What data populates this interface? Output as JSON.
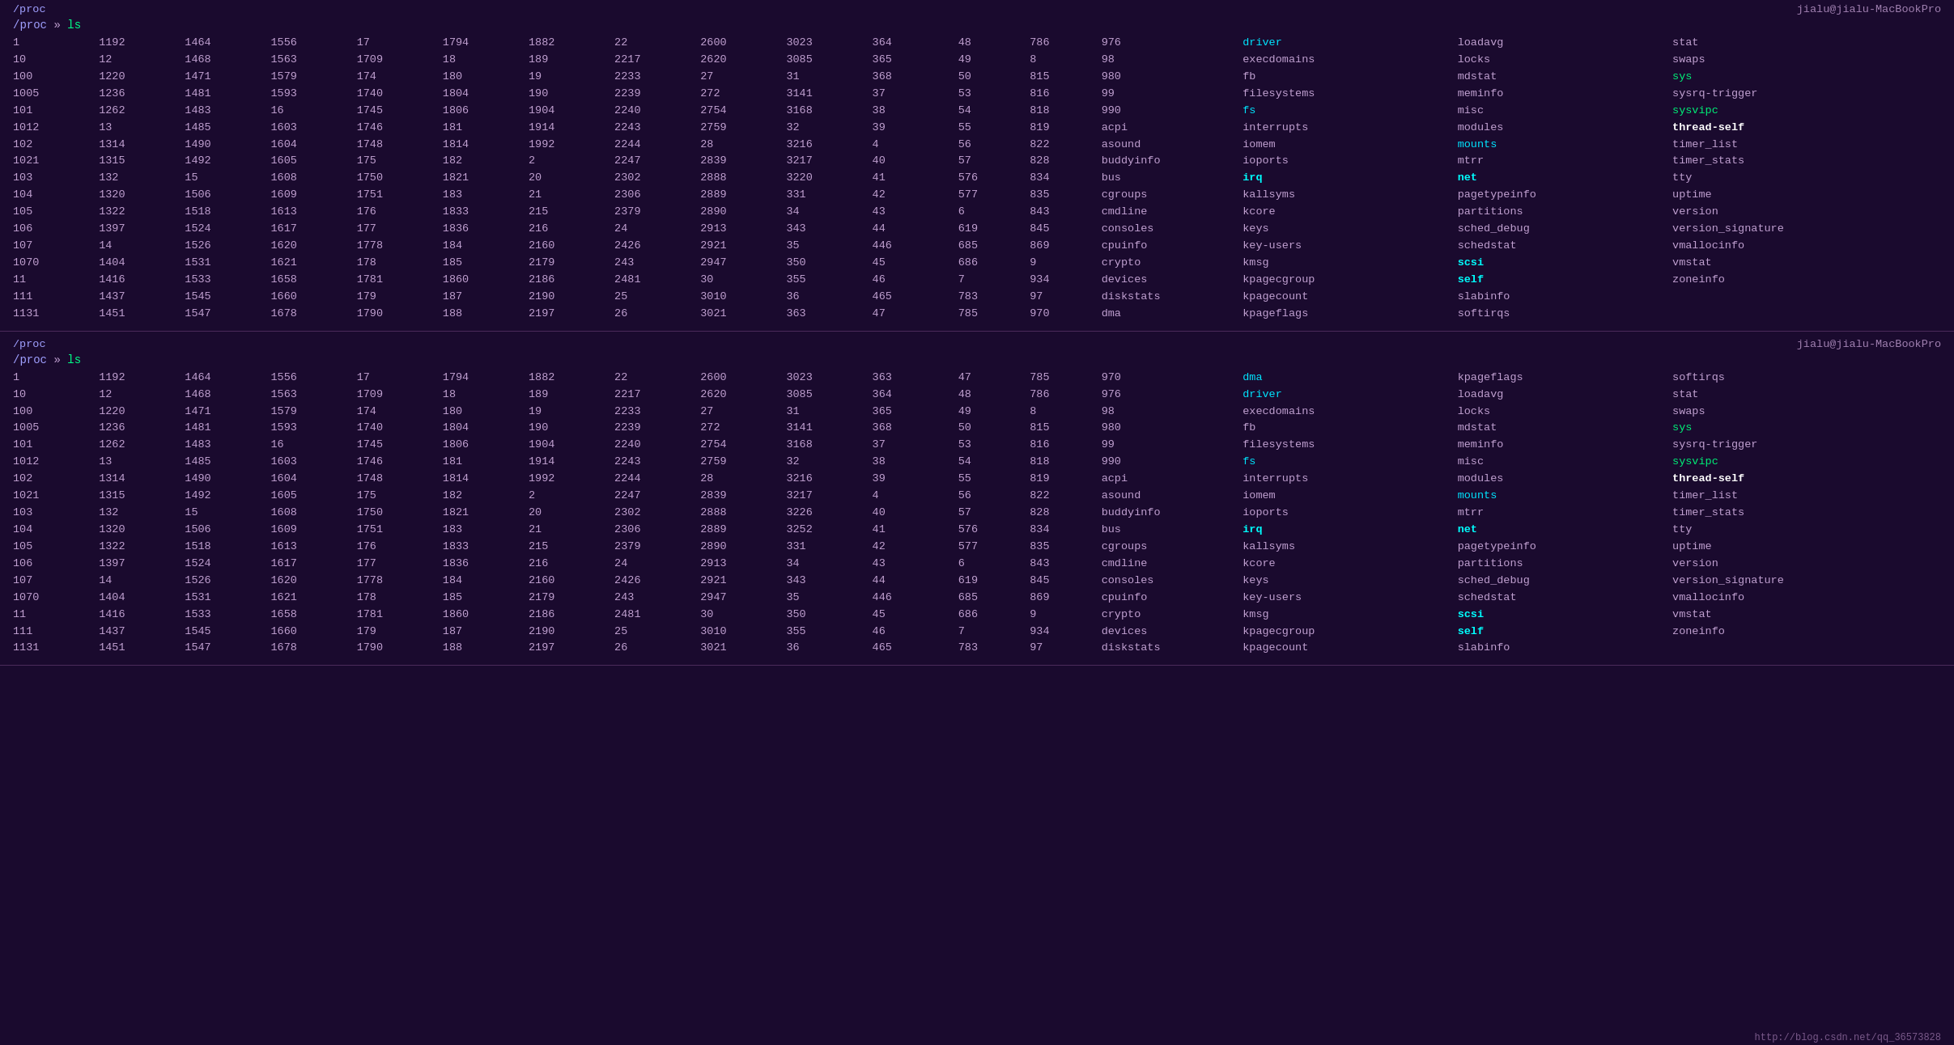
{
  "terminal": {
    "title": "jialu@jialu-MacBookPro",
    "prompt": "/proc",
    "cmd": "ls",
    "url": "http://blog.csdn.net/qq_36573828"
  },
  "section1": {
    "rows": [
      [
        "1",
        "1192",
        "1464",
        "1556",
        "17",
        "1794",
        "1882",
        "22",
        "2600",
        "3023",
        "364",
        "48",
        "786",
        "976",
        "driver",
        "loadavg",
        "stat"
      ],
      [
        "10",
        "12",
        "1468",
        "1563",
        "1709",
        "18",
        "189",
        "2217",
        "2620",
        "3085",
        "365",
        "49",
        "8",
        "98",
        "execdomains",
        "locks",
        "swaps"
      ],
      [
        "100",
        "1220",
        "1471",
        "1579",
        "174",
        "180",
        "19",
        "2233",
        "27",
        "31",
        "368",
        "50",
        "815",
        "980",
        "fb",
        "mdstat",
        "sys"
      ],
      [
        "1005",
        "1236",
        "1481",
        "1593",
        "1740",
        "1804",
        "190",
        "2239",
        "272",
        "3141",
        "37",
        "53",
        "816",
        "99",
        "filesystems",
        "meminfo",
        "sysrq-trigger"
      ],
      [
        "101",
        "1262",
        "1483",
        "16",
        "1745",
        "1806",
        "1904",
        "2240",
        "2754",
        "3168",
        "38",
        "54",
        "818",
        "990",
        "fs",
        "misc",
        "sysvipc"
      ],
      [
        "1012",
        "13",
        "1485",
        "1603",
        "1746",
        "181",
        "1914",
        "2243",
        "2759",
        "32",
        "39",
        "55",
        "819",
        "acpi",
        "interrupts",
        "modules",
        "thread-self"
      ],
      [
        "102",
        "1314",
        "1490",
        "1604",
        "1748",
        "1814",
        "1992",
        "2244",
        "28",
        "3216",
        "4",
        "56",
        "822",
        "asound",
        "iomem",
        "mounts",
        "timer_list"
      ],
      [
        "1021",
        "1315",
        "1492",
        "1605",
        "175",
        "182",
        "2",
        "2247",
        "2839",
        "3217",
        "40",
        "57",
        "828",
        "buddyinfo",
        "ioports",
        "mtrr",
        "timer_stats"
      ],
      [
        "103",
        "132",
        "15",
        "1608",
        "1750",
        "1821",
        "20",
        "2302",
        "2888",
        "3220",
        "41",
        "576",
        "834",
        "bus",
        "irq",
        "net",
        "tty"
      ],
      [
        "104",
        "1320",
        "1506",
        "1609",
        "1751",
        "183",
        "21",
        "2306",
        "2889",
        "331",
        "42",
        "577",
        "835",
        "cgroups",
        "kallsyms",
        "pagetypeinfo",
        "uptime"
      ],
      [
        "105",
        "1322",
        "1518",
        "1613",
        "176",
        "1833",
        "215",
        "2379",
        "2890",
        "34",
        "43",
        "6",
        "843",
        "cmdline",
        "kcore",
        "partitions",
        "version"
      ],
      [
        "106",
        "1397",
        "1524",
        "1617",
        "177",
        "1836",
        "216",
        "24",
        "2913",
        "343",
        "44",
        "619",
        "845",
        "consoles",
        "keys",
        "sched_debug",
        "version_signature"
      ],
      [
        "107",
        "14",
        "1526",
        "1620",
        "1778",
        "184",
        "2160",
        "2426",
        "2921",
        "35",
        "446",
        "685",
        "869",
        "cpuinfo",
        "key-users",
        "schedstat",
        "vmallocinfo"
      ],
      [
        "1070",
        "1404",
        "1531",
        "1621",
        "178",
        "185",
        "2179",
        "243",
        "2947",
        "350",
        "45",
        "686",
        "9",
        "crypto",
        "kmsg",
        "scsi",
        "vmstat"
      ],
      [
        "11",
        "1416",
        "1533",
        "1658",
        "1781",
        "1860",
        "2186",
        "2481",
        "30",
        "355",
        "46",
        "7",
        "934",
        "devices",
        "kpagecgroup",
        "self",
        "zoneinfo"
      ],
      [
        "111",
        "1437",
        "1545",
        "1660",
        "179",
        "187",
        "2190",
        "25",
        "3010",
        "36",
        "465",
        "783",
        "97",
        "diskstats",
        "kpagecount",
        "slabinfo",
        ""
      ],
      [
        "1131",
        "1451",
        "1547",
        "1678",
        "1790",
        "188",
        "2197",
        "26",
        "3021",
        "363",
        "47",
        "785",
        "970",
        "dma",
        "kpageflags",
        "softirqs",
        ""
      ]
    ]
  },
  "section2": {
    "rows": [
      [
        "1",
        "1192",
        "1464",
        "1556",
        "17",
        "1794",
        "1882",
        "22",
        "2600",
        "3023",
        "363",
        "47",
        "785",
        "970",
        "dma",
        "kpageflags",
        "softirqs"
      ],
      [
        "10",
        "12",
        "1468",
        "1563",
        "1709",
        "18",
        "189",
        "2217",
        "2620",
        "3085",
        "364",
        "48",
        "786",
        "976",
        "driver",
        "loadavg",
        "stat"
      ],
      [
        "100",
        "1220",
        "1471",
        "1579",
        "174",
        "180",
        "19",
        "2233",
        "27",
        "31",
        "365",
        "49",
        "8",
        "98",
        "execdomains",
        "locks",
        "swaps"
      ],
      [
        "1005",
        "1236",
        "1481",
        "1593",
        "1740",
        "1804",
        "190",
        "2239",
        "272",
        "3141",
        "368",
        "50",
        "815",
        "980",
        "fb",
        "mdstat",
        "sys"
      ],
      [
        "101",
        "1262",
        "1483",
        "16",
        "1745",
        "1806",
        "1904",
        "2240",
        "2754",
        "3168",
        "37",
        "53",
        "816",
        "99",
        "filesystems",
        "meminfo",
        "sysrq-trigger"
      ],
      [
        "1012",
        "13",
        "1485",
        "1603",
        "1746",
        "181",
        "1914",
        "2243",
        "2759",
        "32",
        "38",
        "54",
        "818",
        "990",
        "fs",
        "misc",
        "sysvipc"
      ],
      [
        "102",
        "1314",
        "1490",
        "1604",
        "1748",
        "1814",
        "1992",
        "2244",
        "28",
        "3216",
        "39",
        "55",
        "819",
        "acpi",
        "interrupts",
        "modules",
        "thread-self"
      ],
      [
        "1021",
        "1315",
        "1492",
        "1605",
        "175",
        "182",
        "2",
        "2247",
        "2839",
        "3217",
        "4",
        "56",
        "822",
        "asound",
        "iomem",
        "mounts",
        "timer_list"
      ],
      [
        "103",
        "132",
        "15",
        "1608",
        "1750",
        "1821",
        "20",
        "2302",
        "2888",
        "3226",
        "40",
        "57",
        "828",
        "buddyinfo",
        "ioports",
        "mtrr",
        "timer_stats"
      ],
      [
        "104",
        "1320",
        "1506",
        "1609",
        "1751",
        "183",
        "21",
        "2306",
        "2889",
        "3252",
        "41",
        "576",
        "834",
        "bus",
        "irq",
        "net",
        "tty"
      ],
      [
        "105",
        "1322",
        "1518",
        "1613",
        "176",
        "1833",
        "215",
        "2379",
        "2890",
        "331",
        "42",
        "577",
        "835",
        "cgroups",
        "kallsyms",
        "pagetypeinfo",
        "uptime"
      ],
      [
        "106",
        "1397",
        "1524",
        "1617",
        "177",
        "1836",
        "216",
        "24",
        "2913",
        "34",
        "43",
        "6",
        "843",
        "cmdline",
        "kcore",
        "partitions",
        "version"
      ],
      [
        "107",
        "14",
        "1526",
        "1620",
        "1778",
        "184",
        "2160",
        "2426",
        "2921",
        "343",
        "44",
        "619",
        "845",
        "consoles",
        "keys",
        "sched_debug",
        "version_signature"
      ],
      [
        "1070",
        "1404",
        "1531",
        "1621",
        "178",
        "185",
        "2179",
        "243",
        "2947",
        "35",
        "446",
        "685",
        "869",
        "cpuinfo",
        "key-users",
        "schedstat",
        "vmallocinfo"
      ],
      [
        "11",
        "1416",
        "1533",
        "1658",
        "1781",
        "1860",
        "2186",
        "2481",
        "30",
        "350",
        "45",
        "686",
        "9",
        "crypto",
        "kmsg",
        "scsi",
        "vmstat"
      ],
      [
        "111",
        "1437",
        "1545",
        "1660",
        "179",
        "187",
        "2190",
        "25",
        "3010",
        "355",
        "46",
        "7",
        "934",
        "devices",
        "kpagecgroup",
        "self",
        "zoneinfo"
      ],
      [
        "1131",
        "1451",
        "1547",
        "1678",
        "1790",
        "188",
        "2197",
        "26",
        "3021",
        "36",
        "465",
        "783",
        "97",
        "diskstats",
        "kpagecount",
        "slabinfo",
        ""
      ]
    ]
  }
}
